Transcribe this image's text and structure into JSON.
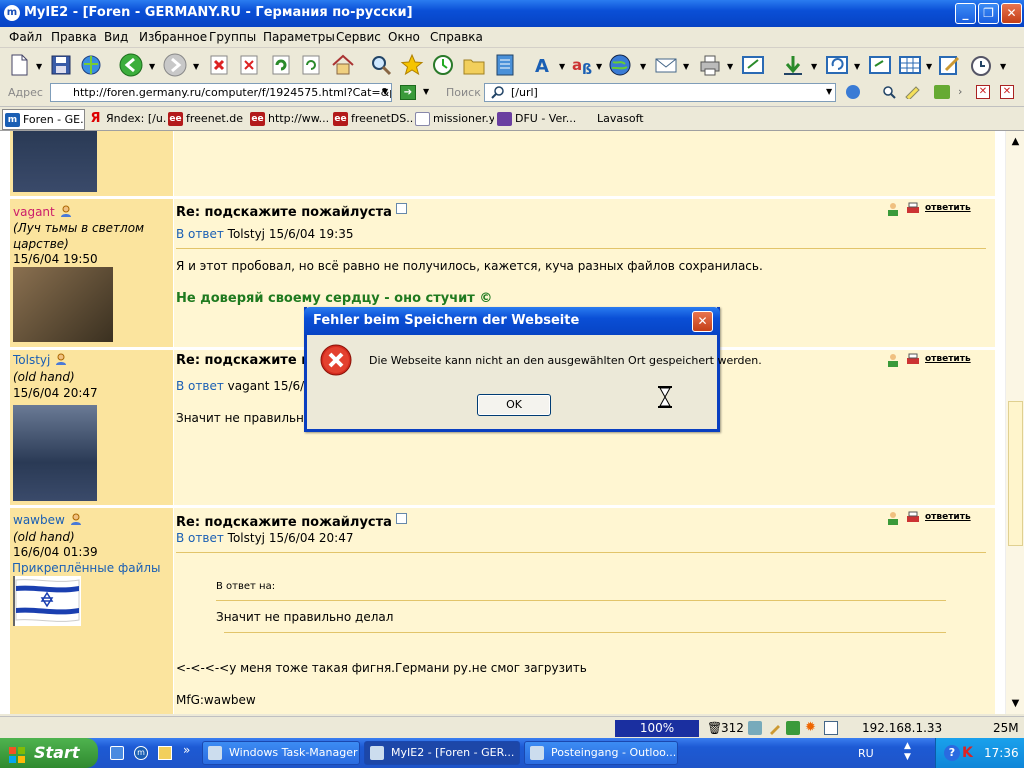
{
  "window": {
    "title": "MyIE2 - [Foren - GERMANY.RU - Германия по-русски]",
    "app_icon": "m"
  },
  "menu": [
    "Файл",
    "Правка",
    "Вид",
    "Избранное",
    "Группы",
    "Параметры",
    "Сервис",
    "Окно",
    "Справка"
  ],
  "address": {
    "label": "Адрес",
    "url": "http://foren.germany.ru/computer/f/1924575.html?Cat=&page",
    "search_label": "Поиск",
    "search_value": "[/url]"
  },
  "tabs": [
    {
      "label": "Foren - GE...",
      "icon": "m"
    },
    {
      "label": "Яndex: [/u...",
      "icon": "Я"
    },
    {
      "label": "freenet.de ...",
      "icon": "ee"
    },
    {
      "label": "http://ww...",
      "icon": "ee"
    },
    {
      "label": "freenetDS...",
      "icon": "ee"
    },
    {
      "label": "missioner.y...",
      "icon": "page"
    },
    {
      "label": "DFU - Ver...",
      "icon": "stop"
    },
    {
      "label": "Lavasoft",
      "icon": ""
    }
  ],
  "posts": [
    {
      "username": "vagant",
      "user_title": "(Луч тьмы в светлом царстве)",
      "date": "15/6/04 19:50",
      "subject": "Re: подскажите пожайлуста",
      "reply_prefix": "В ответ",
      "reply_to": "Tolstyj 15/6/04 19:35",
      "text": "Я и этот пробовал, но всё равно не получилось, кажется, куча разных файлов сохранилась.",
      "signature": "Не доверяй своему сердцу - оно стучит ©",
      "reply_button": "ответить"
    },
    {
      "username": "Tolstyj",
      "user_title": "(old hand)",
      "date": "15/6/04 20:47",
      "subject": "Re: подскажите по",
      "reply_prefix": "В ответ",
      "reply_to": "vagant 15/6/0",
      "text": "Значит не правильно",
      "reply_button": "ответить"
    },
    {
      "username": "wawbew",
      "user_title": "(old hand)",
      "date": "16/6/04 01:39",
      "attachments": "Прикреплённые файлы",
      "subject": "Re: подскажите пожайлуста",
      "reply_prefix": "В ответ",
      "reply_to": "Tolstyj 15/6/04 20:47",
      "quote_label": "В ответ на:",
      "quote_text": "Значит не правильно делал",
      "text": "<-<-<-<у меня тоже такая фигня.Германи ру.не смог загрузить",
      "signature": "MfG:wawbew",
      "reply_button": "ответить"
    }
  ],
  "dialog": {
    "title": "Fehler beim Speichern der Webseite",
    "message": "Die Webseite kann nicht an den ausgewählten Ort gespeichert werden.",
    "ok": "OK"
  },
  "status": {
    "zoom": "100%",
    "blocked_count": "312",
    "ip": "192.168.1.33",
    "memory": "25M"
  },
  "taskbar": {
    "start": "Start",
    "items": [
      "Windows Task-Manager",
      "MyIE2 - [Foren - GER...",
      "Posteingang - Outloo..."
    ],
    "lang": "RU",
    "clock": "17:36"
  }
}
